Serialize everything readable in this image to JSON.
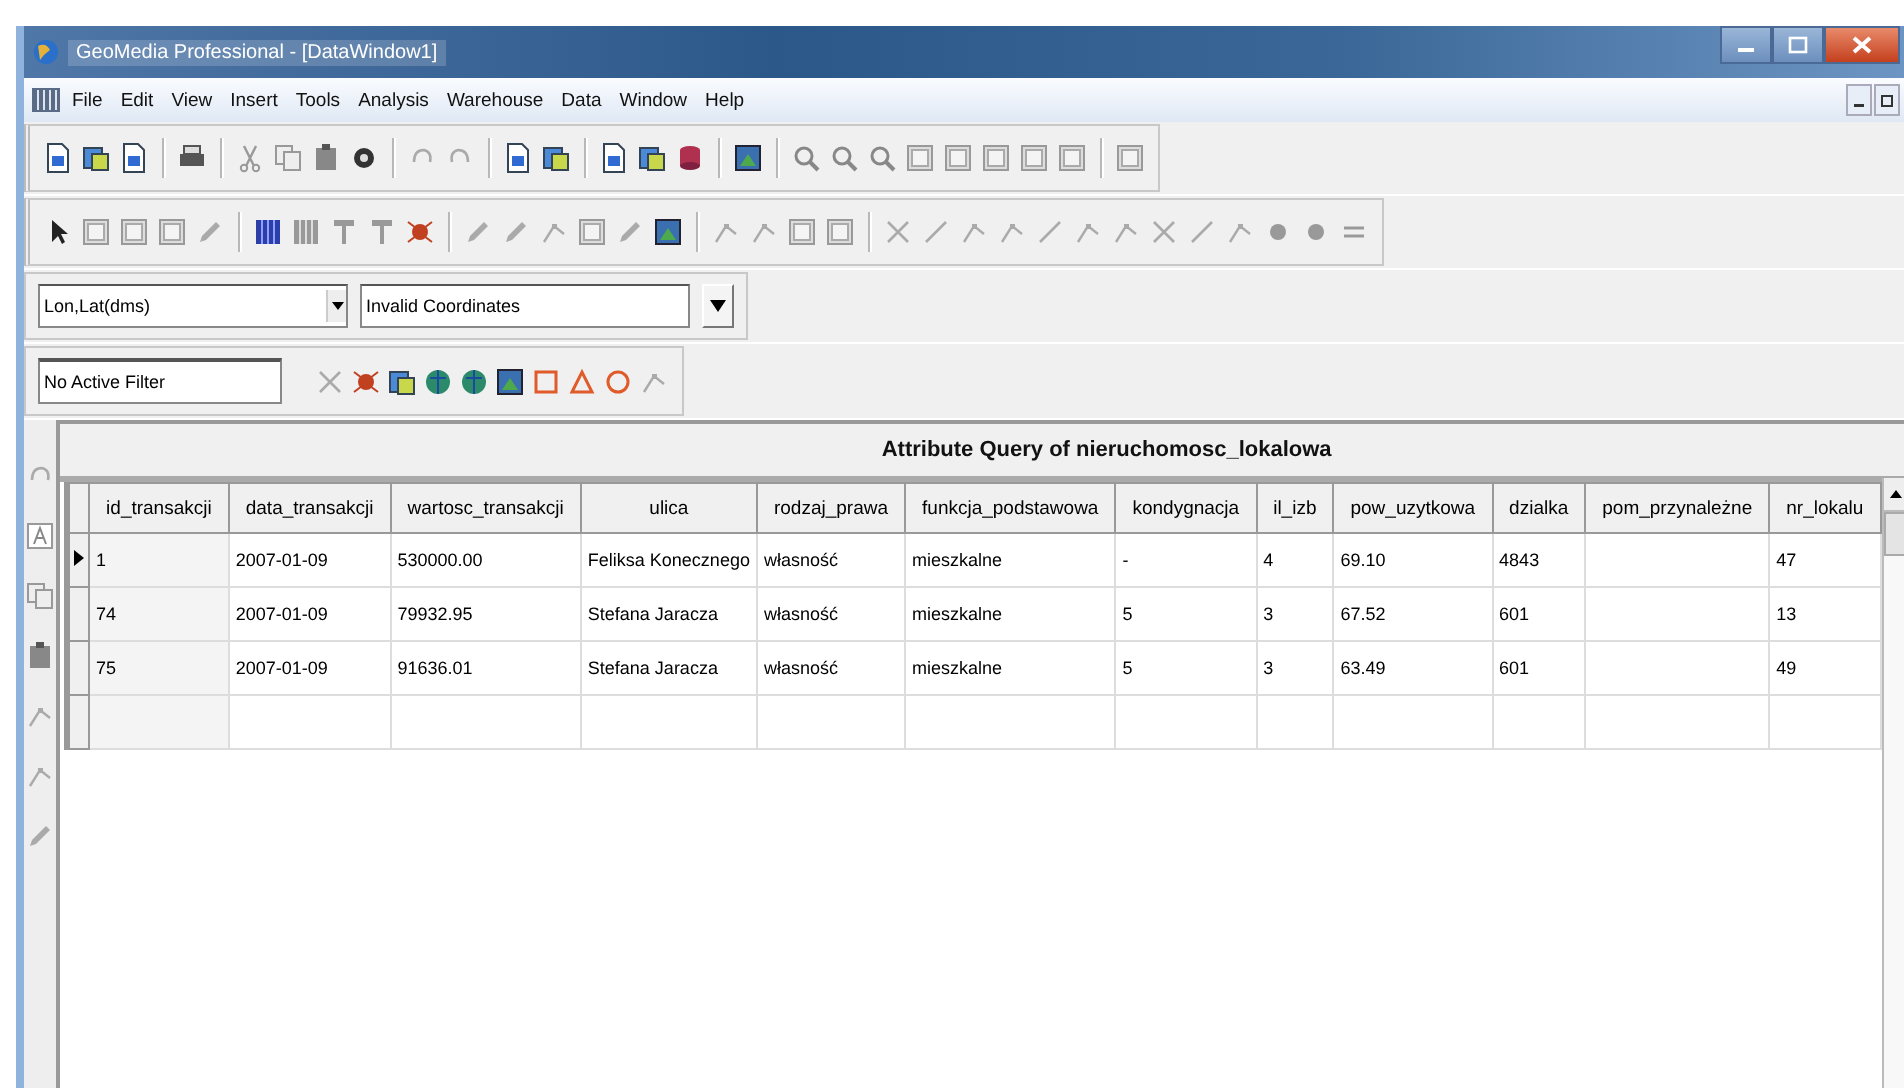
{
  "window": {
    "title": "GeoMedia Professional - [DataWindow1]"
  },
  "menu": [
    "File",
    "Edit",
    "View",
    "Insert",
    "Tools",
    "Analysis",
    "Warehouse",
    "Data",
    "Window",
    "Help"
  ],
  "coordinates": {
    "system": "Lon,Lat(dms)",
    "value": "Invalid Coordinates"
  },
  "filter": {
    "value": "No Active Filter"
  },
  "table": {
    "caption": "Attribute Query of nieruchomosc_lokalowa",
    "columns": [
      "id_transakcji",
      "data_transakcji",
      "wartosc_transakcji",
      "ulica",
      "rodzaj_prawa",
      "funkcja_podstawowa",
      "kondygnacja",
      "il_izb",
      "pow_uzytkowa",
      "dzialka",
      "pom_przynależne",
      "nr_lokalu"
    ],
    "rows": [
      {
        "current": true,
        "cells": [
          "1",
          "2007-01-09",
          "530000.00",
          "Feliksa Konecznego",
          "własność",
          "mieszkalne",
          "-",
          "4",
          "69.10",
          "4843",
          "",
          "47"
        ]
      },
      {
        "current": false,
        "cells": [
          "74",
          "2007-01-09",
          "79932.95",
          "Stefana Jaracza",
          "własność",
          "mieszkalne",
          "5",
          "3",
          "67.52",
          "601",
          "",
          "13"
        ]
      },
      {
        "current": false,
        "cells": [
          "75",
          "2007-01-09",
          "91636.01",
          "Stefana Jaracza",
          "własność",
          "mieszkalne",
          "5",
          "3",
          "63.49",
          "601",
          "",
          "49"
        ]
      }
    ]
  }
}
